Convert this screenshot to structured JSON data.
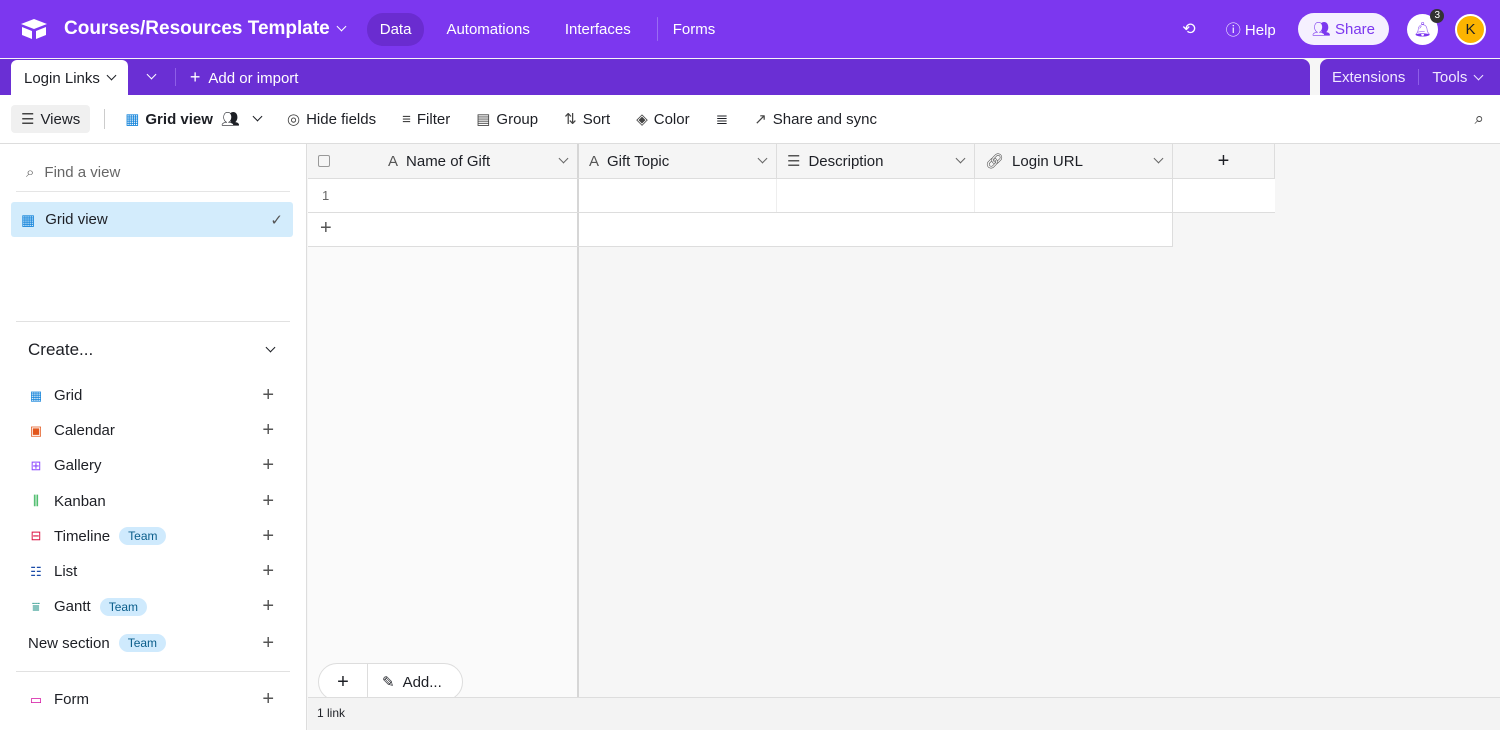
{
  "header": {
    "title": "Courses/Resources Template",
    "nav": [
      "Data",
      "Automations",
      "Interfaces",
      "Forms"
    ],
    "help": "Help",
    "share": "Share",
    "notifications": "3",
    "avatar": "K"
  },
  "tabs": {
    "active": "Login Links",
    "add": "Add or import",
    "extensions": "Extensions",
    "tools": "Tools"
  },
  "toolbar": {
    "views": "Views",
    "grid_view": "Grid view",
    "hide_fields": "Hide fields",
    "filter": "Filter",
    "group": "Group",
    "sort": "Sort",
    "color": "Color",
    "share_sync": "Share and sync"
  },
  "sidebar": {
    "find_placeholder": "Find a view",
    "current_view": "Grid view",
    "create": "Create...",
    "items": [
      {
        "label": "Grid"
      },
      {
        "label": "Calendar"
      },
      {
        "label": "Gallery"
      },
      {
        "label": "Kanban"
      },
      {
        "label": "Timeline",
        "badge": "Team"
      },
      {
        "label": "List"
      },
      {
        "label": "Gantt",
        "badge": "Team"
      },
      {
        "label": "New section",
        "badge": "Team"
      }
    ],
    "form": "Form"
  },
  "grid": {
    "columns": [
      "Name of Gift",
      "Gift Topic",
      "Description",
      "Login URL"
    ],
    "rows": [
      {
        "num": "1"
      }
    ],
    "add_label": "Add...",
    "footer": "1 link"
  },
  "colors": {
    "brand": "#7c37ef",
    "accent": "#fcb400"
  }
}
